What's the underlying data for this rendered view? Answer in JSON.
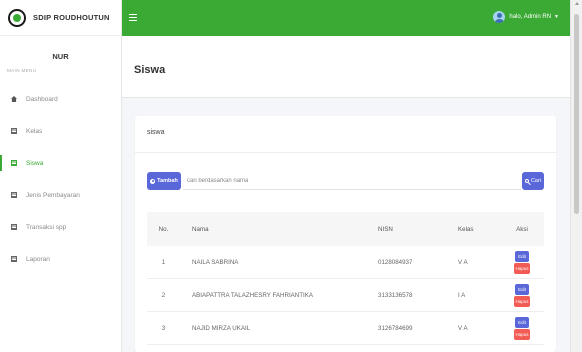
{
  "brand": {
    "name": "SDIP ROUDHOUTUN"
  },
  "user_panel": {
    "name": "NUR"
  },
  "sidebar": {
    "header": "MAIN MENU",
    "items": [
      {
        "label": "Dashboard",
        "icon": "home-icon"
      },
      {
        "label": "Kelas",
        "icon": "grid-icon"
      },
      {
        "label": "Siswa",
        "icon": "grid-icon",
        "active": true
      },
      {
        "label": "Jenis Pembayaran",
        "icon": "grid-icon"
      },
      {
        "label": "Transaksi spp",
        "icon": "grid-icon"
      },
      {
        "label": "Laporan",
        "icon": "grid-icon"
      }
    ]
  },
  "topbar": {
    "greeting": "halo, Admin RN",
    "caret": "▼"
  },
  "page": {
    "title": "Siswa"
  },
  "card": {
    "title": "siswa",
    "add_button": "Tambah",
    "search": {
      "placeholder": "cari berdasarkan nama",
      "value": ""
    },
    "search_button": "Cari"
  },
  "table": {
    "headers": {
      "no": "No.",
      "nama": "Nama",
      "nisn": "NISN",
      "kelas": "Kelas",
      "aksi": "Aksi"
    },
    "rows": [
      {
        "no": "1",
        "nama": "NAILA SABRINA",
        "nisn": "0128084937",
        "kelas": "V A"
      },
      {
        "no": "2",
        "nama": "ABIAPATTRA TALAZHESRY FAHRIANTIKA",
        "nisn": "3133136578",
        "kelas": "I A"
      },
      {
        "no": "3",
        "nama": "NAJID MIRZA UKAIL",
        "nisn": "3126784699",
        "kelas": "V A"
      }
    ],
    "edit_label": "Edit",
    "delete_label": "Hapus"
  },
  "colors": {
    "primary_green": "#3aaa35",
    "button_blue": "#5a67d8",
    "delete_red": "#f25c54"
  }
}
